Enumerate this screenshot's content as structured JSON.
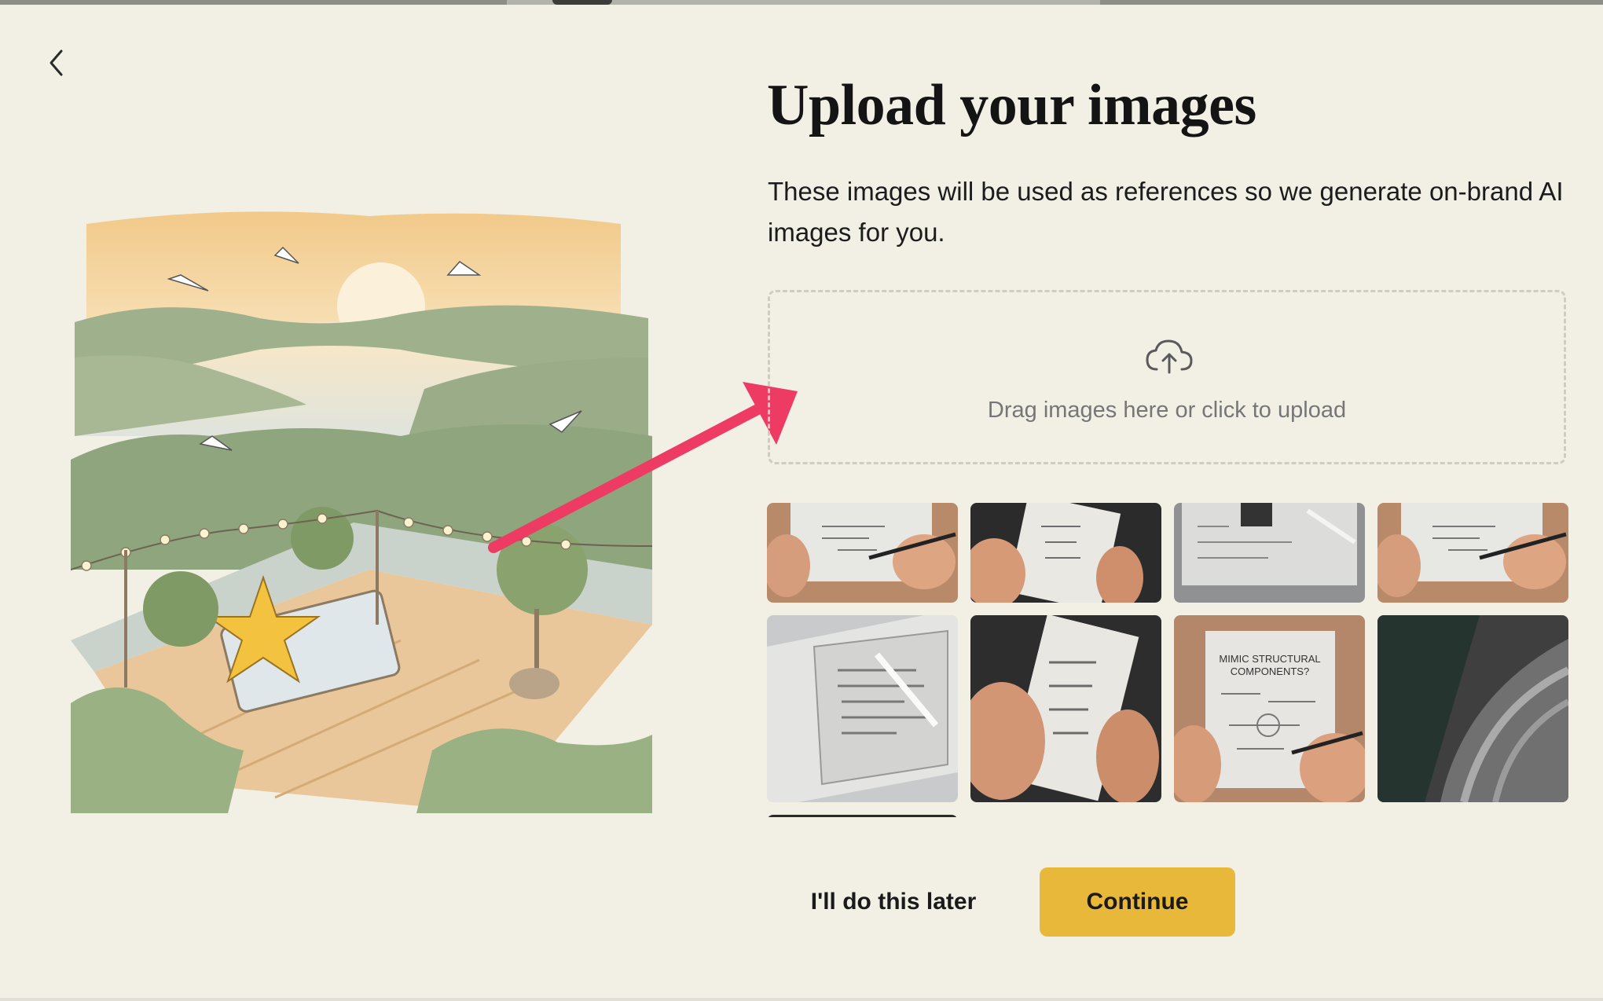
{
  "header": {
    "back_icon": "chevron-left-icon",
    "title": "Upload your images",
    "subtitle": "These images will be used as references so we generate on-brand AI images for you."
  },
  "illustration": {
    "description_icon": "rooftop-terrace-watercolor-illustration",
    "annotation_icon": "arrow-icon",
    "annotation_color": "#ee3b63"
  },
  "dropzone": {
    "icon": "cloud-upload-icon",
    "label": "Drag images here or click to upload"
  },
  "thumbnails": {
    "count_visible": 9,
    "items": [
      {
        "subject": "hand-writing-on-tablet",
        "row": 1
      },
      {
        "subject": "hand-holding-tablet",
        "row": 1
      },
      {
        "subject": "tablet-with-stylus",
        "row": 1
      },
      {
        "subject": "hand-writing-on-tablet",
        "row": 1
      },
      {
        "subject": "tablet-on-desk-angled",
        "row": 2
      },
      {
        "subject": "hand-holding-tablet-closeup",
        "row": 2
      },
      {
        "subject": "tablet-with-handwritten-notes",
        "row": 2,
        "caption": "MIMIC STRUCTURAL COMPONENTS?"
      },
      {
        "subject": "tablet-closeup-dark",
        "row": 2
      },
      {
        "subject": "partial-thumbnail",
        "row": 3
      }
    ]
  },
  "actions": {
    "later_label": "I'll do this later",
    "continue_label": "Continue"
  },
  "colors": {
    "background": "#f2f0e5",
    "accent": "#e8b83a",
    "text": "#141414",
    "muted_text": "#767676",
    "dropzone_border": "#cfcdc3"
  }
}
